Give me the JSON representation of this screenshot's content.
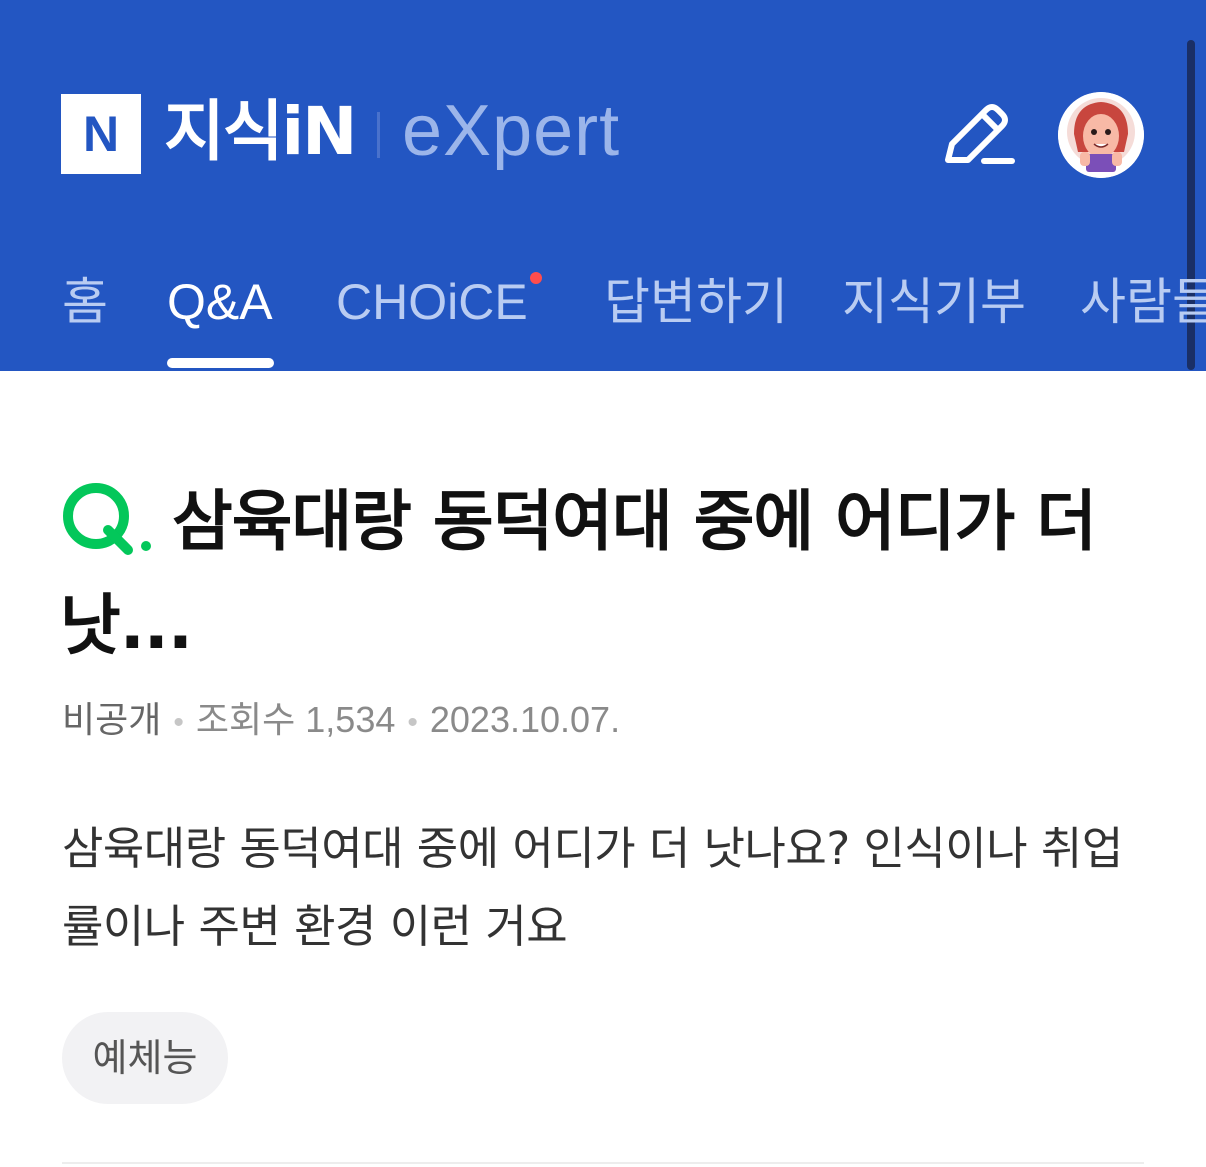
{
  "app": {
    "logo_letter": "N",
    "brand": "지식iN",
    "expert_label": "eXpert",
    "colors": {
      "header_bg": "#2356c2",
      "q_green": "#03c75a",
      "notify_dot": "#ff4d4d"
    }
  },
  "header": {
    "write_icon": "pencil-icon",
    "avatar_icon": "user-avatar"
  },
  "tabs": [
    {
      "label": "홈",
      "active": false
    },
    {
      "label": "Q&A",
      "active": true
    },
    {
      "label": "CHOiCE",
      "active": false,
      "has_dot": true
    },
    {
      "label": "답변하기",
      "active": false
    },
    {
      "label": "지식기부",
      "active": false
    },
    {
      "label": "사람들",
      "active": false
    }
  ],
  "question": {
    "prefix": "Q.",
    "title": "삼육대랑 동덕여대 중에 어디가 더 낫...",
    "author": "비공개",
    "views_label": "조회수",
    "views": "1,534",
    "date": "2023.10.07.",
    "body": "삼육대랑 동덕여대 중에 어디가 더 낫나요? 인식이나 취업률이나 주변 환경 이런 거요",
    "tag": "예체능"
  }
}
